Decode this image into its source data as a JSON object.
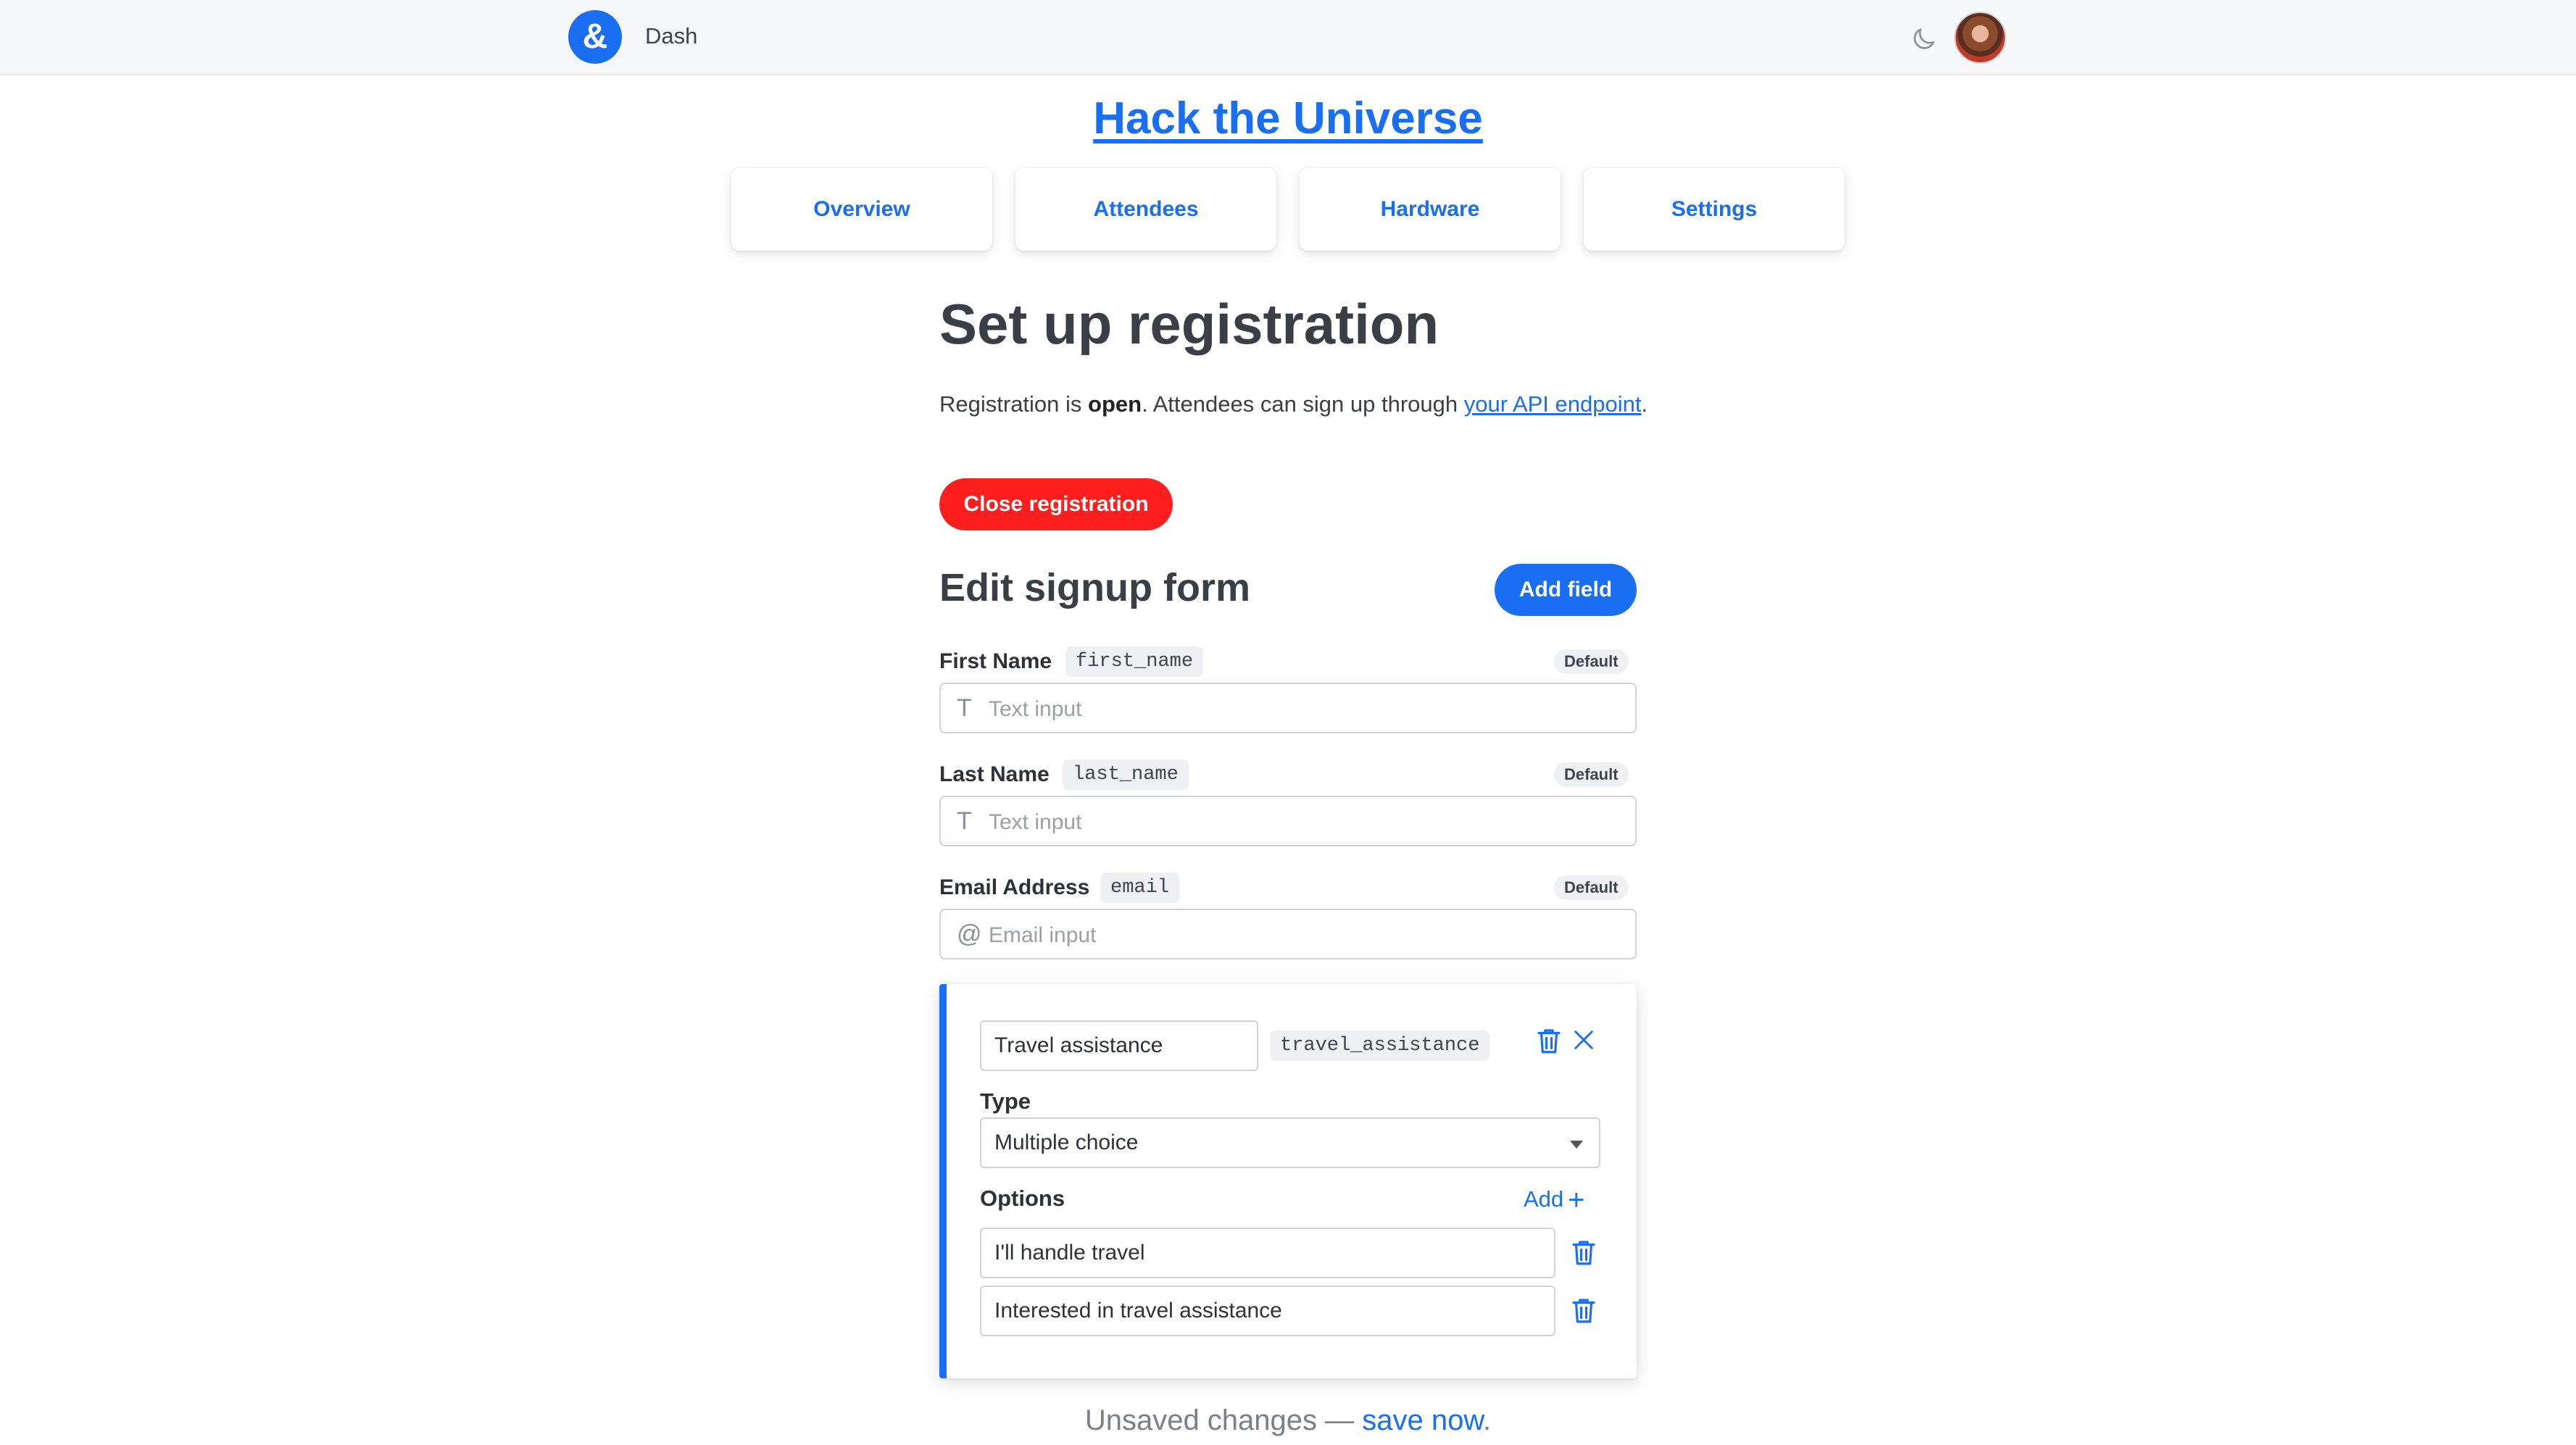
{
  "topbar": {
    "logo_glyph": "&",
    "app_name": "Dash"
  },
  "event": {
    "title": "Hack the Universe"
  },
  "tabs": [
    {
      "label": "Overview"
    },
    {
      "label": "Attendees"
    },
    {
      "label": "Hardware"
    },
    {
      "label": "Settings"
    }
  ],
  "registration": {
    "heading": "Set up registration",
    "text_prefix": "Registration is ",
    "status": "open",
    "text_middle": ". Attendees can sign up through ",
    "link_text": "your API endpoint",
    "text_suffix": ".",
    "close_button": "Close registration"
  },
  "signup_form": {
    "heading": "Edit signup form",
    "add_field_button": "Add field",
    "default_fields": [
      {
        "label": "First Name",
        "key": "first_name",
        "badge": "Default",
        "placeholder": "Text input",
        "icon": "text-icon",
        "icon_glyph": "T"
      },
      {
        "label": "Last Name",
        "key": "last_name",
        "badge": "Default",
        "placeholder": "Text input",
        "icon": "text-icon",
        "icon_glyph": "T"
      },
      {
        "label": "Email Address",
        "key": "email",
        "badge": "Default",
        "placeholder": "Email input",
        "icon": "at-icon",
        "icon_glyph": "@"
      }
    ],
    "editor": {
      "name_value": "Travel assistance",
      "key": "travel_assistance",
      "type_label": "Type",
      "type_value": "Multiple choice",
      "options_label": "Options",
      "add_option": "Add",
      "options": [
        {
          "value": "I'll handle travel"
        },
        {
          "value": "Interested in travel assistance"
        }
      ]
    }
  },
  "footer": {
    "unsaved_text": "Unsaved changes — ",
    "save_link": "save now",
    "period": "."
  },
  "colors": {
    "accent": "#1a6ef2",
    "danger": "#ff1e1e"
  }
}
